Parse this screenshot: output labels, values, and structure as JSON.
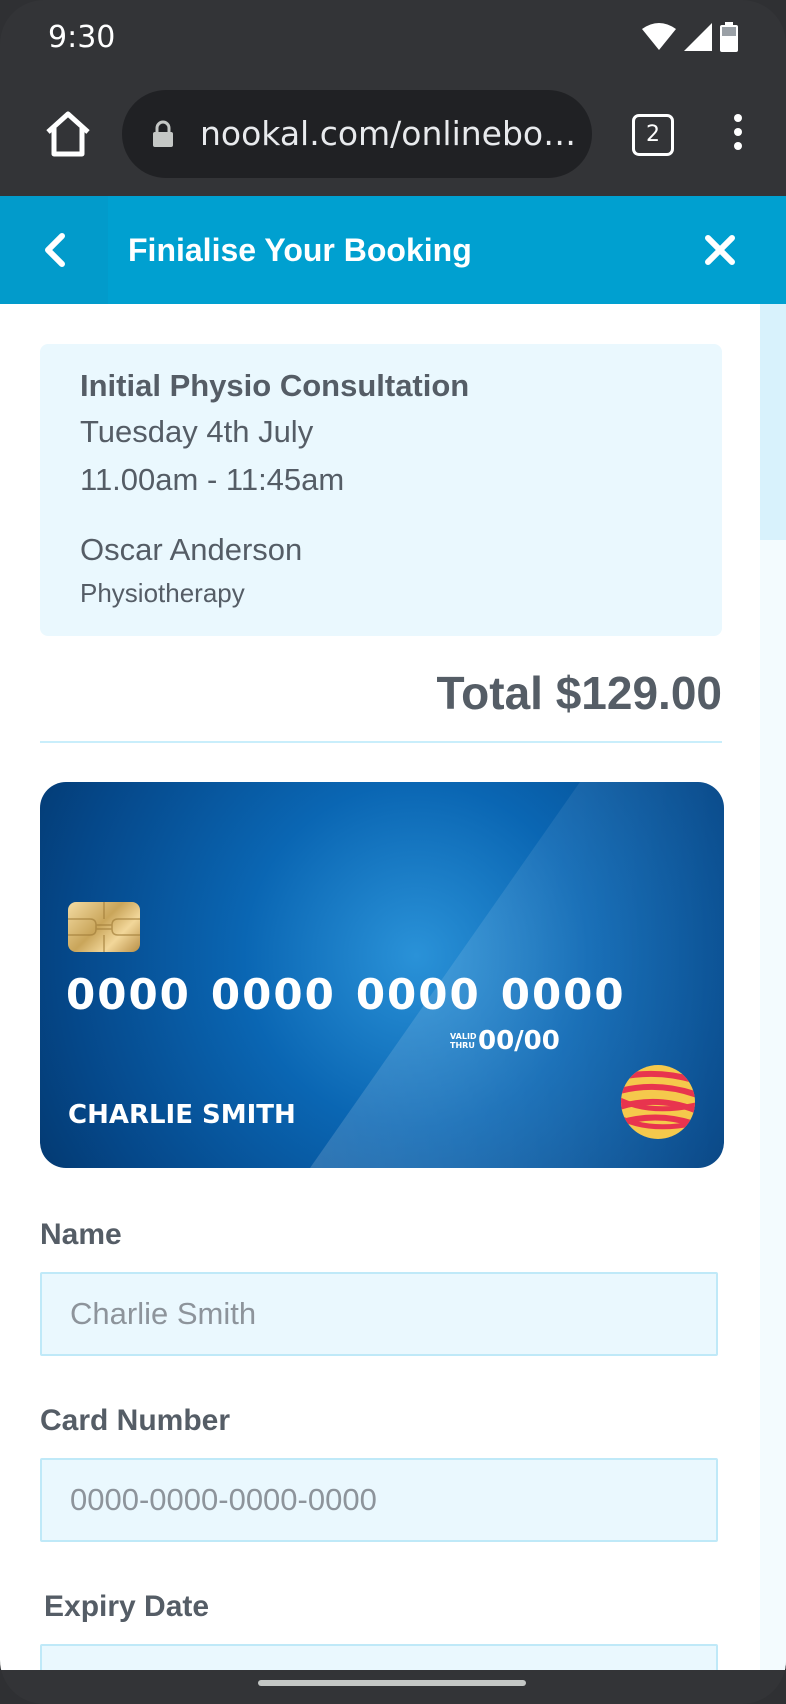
{
  "status_bar": {
    "time": "9:30"
  },
  "browser": {
    "url": "nookal.com/onlinebooking",
    "tab_count": "2"
  },
  "header": {
    "title": "Finialise Your Booking"
  },
  "booking": {
    "title": "Initial Physio Consultation",
    "date": "Tuesday 4th July",
    "time": "11.00am - 11:45am",
    "practitioner": "Oscar Anderson",
    "department": "Physiotherapy"
  },
  "total": "Total $129.00",
  "card": {
    "number_groups": [
      "0000",
      "0000",
      "0000",
      "0000"
    ],
    "valid_label_1": "VALID",
    "valid_label_2": "THRU",
    "expiry": "00/00",
    "holder": "CHARLIE SMITH"
  },
  "form": {
    "name_label": "Name",
    "name_placeholder": "Charlie Smith",
    "card_number_label": "Card Number",
    "card_number_placeholder": "0000-0000-0000-0000",
    "expiry_label": "Expiry Date",
    "expiry_placeholder": ""
  },
  "colors": {
    "header": "#00a0d0",
    "box_bg": "#eaf8fe",
    "text": "#555d66"
  },
  "icons": [
    "wifi-icon",
    "signal-icon",
    "battery-icon",
    "home-icon",
    "lock-icon",
    "tabs-icon",
    "more-vert-icon",
    "back-chevron-icon",
    "close-icon",
    "card-chip-icon",
    "card-network-logo-icon"
  ]
}
